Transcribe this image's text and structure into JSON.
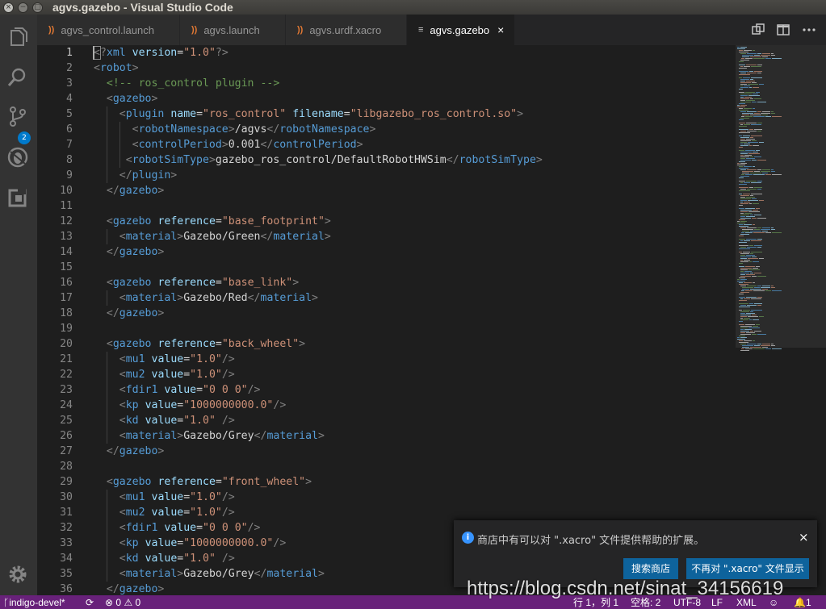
{
  "window": {
    "title": "agvs.gazebo - Visual Studio Code",
    "controls": [
      "×",
      "−",
      "□"
    ]
  },
  "activity_bar": {
    "items": [
      {
        "name": "explorer-icon"
      },
      {
        "name": "search-icon"
      },
      {
        "name": "source-control-icon",
        "badge": "2"
      },
      {
        "name": "debug-icon"
      },
      {
        "name": "extensions-icon"
      },
      {
        "name": "settings-gear-icon"
      }
    ]
  },
  "tabs": [
    {
      "label": "agvs_control.launch",
      "icon": "rss-icon",
      "active": false
    },
    {
      "label": "agvs.launch",
      "icon": "rss-icon",
      "active": false
    },
    {
      "label": "agvs.urdf.xacro",
      "icon": "rss-icon",
      "active": false
    },
    {
      "label": "agvs.gazebo",
      "icon": "lines-icon",
      "active": true,
      "close": "×"
    }
  ],
  "editor_actions": [
    "split-compare-icon",
    "split-editor-icon",
    "more-icon"
  ],
  "editor": {
    "lines": [
      "<?xml version=\"1.0\"?>",
      "<robot>",
      "  <!-- ros_control plugin -->",
      "  <gazebo>",
      "    <plugin name=\"ros_control\" filename=\"libgazebo_ros_control.so\">",
      "      <robotNamespace>/agvs</robotNamespace>",
      "      <controlPeriod>0.001</controlPeriod>",
      "     <robotSimType>gazebo_ros_control/DefaultRobotHWSim</robotSimType>",
      "    </plugin>",
      "  </gazebo>",
      "",
      "  <gazebo reference=\"base_footprint\">",
      "    <material>Gazebo/Green</material>",
      "  </gazebo>",
      "",
      "  <gazebo reference=\"base_link\">",
      "    <material>Gazebo/Red</material>",
      "  </gazebo>",
      "",
      "  <gazebo reference=\"back_wheel\">",
      "    <mu1 value=\"1.0\"/>",
      "    <mu2 value=\"1.0\"/>",
      "    <fdir1 value=\"0 0 0\"/>",
      "    <kp value=\"1000000000.0\"/>",
      "    <kd value=\"1.0\" />",
      "    <material>Gazebo/Grey</material>",
      "  </gazebo>",
      "",
      "  <gazebo reference=\"front_wheel\">",
      "    <mu1 value=\"1.0\"/>",
      "    <mu2 value=\"1.0\"/>",
      "    <fdir1 value=\"0 0 0\"/>",
      "    <kp value=\"1000000000.0\"/>",
      "    <kd value=\"1.0\" />",
      "    <material>Gazebo/Grey</material>",
      "  </gazebo>"
    ],
    "current_line": 1
  },
  "notification": {
    "message": "商店中有可以对 \".xacro\" 文件提供帮助的扩展。",
    "close": "×",
    "info_glyph": "i",
    "buttons": [
      "搜索商店",
      "不再对 \".xacro\" 文件显示"
    ]
  },
  "watermark": "https://blog.csdn.net/sinat_34156619",
  "status_bar": {
    "branch": "indigo-devel*",
    "errors": "0",
    "warnings": "0",
    "position": "行 1，列 1",
    "indent": "空格: 2",
    "encoding": "UTF-8",
    "eol": "LF",
    "language": "XML",
    "notifications": "1"
  },
  "colors": {
    "status_bar": "#68217a",
    "activity_bar": "#333333",
    "editor_bg": "#1e1e1e",
    "button": "#0e639c"
  }
}
